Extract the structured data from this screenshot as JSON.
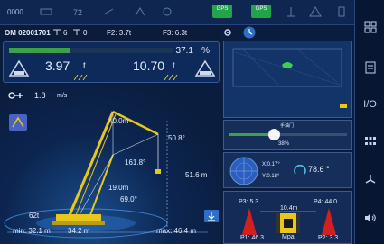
{
  "top_bar": {
    "code": "0000",
    "gps1": "GPS",
    "gps2": "GPS"
  },
  "info_row": {
    "om_id": "OM 02001701",
    "counter1": "6",
    "counter2": "0",
    "f2": "F2: 3.7t",
    "f3": "F3: 6.3t"
  },
  "load": {
    "percent": "37.1",
    "percent_unit": "%",
    "percent_value": 37.1,
    "actual": "3.97",
    "actual_unit": "t",
    "rated": "10.70",
    "rated_unit": "t"
  },
  "wind": {
    "value": "1.8",
    "unit": "m/s"
  },
  "crane": {
    "boom_length": "40.0m",
    "jib_angle": "50.8°",
    "jib_boom_angle": "161.8°",
    "height": "51.6 m",
    "luff_length": "19.0m",
    "boom_angle": "69.0°",
    "counterweight": "62t",
    "min_radius": "min: 32.1 m",
    "radius": "34.2 m",
    "max_radius": "max: 46.4 m"
  },
  "throttle": {
    "label": "手油门",
    "value": "38%",
    "value_num": 38
  },
  "tilt": {
    "x": "X:0.17°",
    "y": "Y:0.18°",
    "slew": "78.6 °"
  },
  "pressure": {
    "p3": "P3: 5.3",
    "p4": "P4: 44.0",
    "p1": "P1: 46.3",
    "p2": "P2: 3.3",
    "track": "10.4m",
    "unit": "Mpa"
  },
  "sidebar": {
    "io": "I/O"
  },
  "colors": {
    "accent_green": "#3fa04a",
    "boom_yellow": "#e8c61a",
    "panel_border": "#345a99"
  }
}
